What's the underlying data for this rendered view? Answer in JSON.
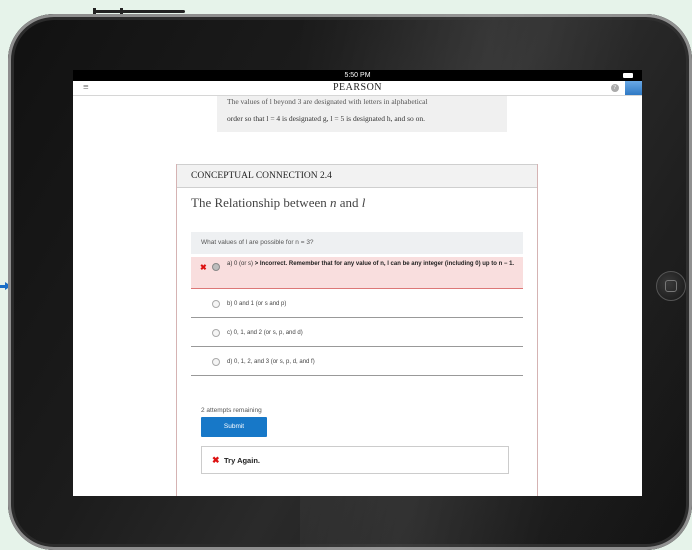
{
  "status_bar": {
    "time": "5:50 PM"
  },
  "app_bar": {
    "brand": "PEARSON",
    "menu_glyph": "≡",
    "help_glyph": "?"
  },
  "previous_passage": {
    "line1": "The values of l beyond 3 are designated with letters in alphabetical",
    "line2": "order so that l = 4 is designated g, l = 5 is designated h, and so on."
  },
  "card": {
    "header": "CONCEPTUAL CONNECTION 2.4",
    "title_prefix": "The Relationship between ",
    "title_n": "n",
    "title_and": " and ",
    "title_l": "l",
    "question": "What values of l are possible for n = 3?",
    "options": [
      {
        "label": "a) 0 (or s)",
        "feedback_bold": "> Incorrect. Remember that for any value of n, l can be any integer (including 0) up to n − 1.",
        "state": "incorrect-selected"
      },
      {
        "label": "b) 0 and 1 (or s and p)",
        "state": "unselected"
      },
      {
        "label": "c) 0, 1, and 2 (or s, p, and d)",
        "state": "unselected"
      },
      {
        "label": "d) 0, 1, 2, and 3 (or s, p, d, and f)",
        "state": "unselected"
      }
    ],
    "attempts_text": "2 attempts remaining",
    "submit_label": "Submit",
    "result_icon": "x-mark-icon",
    "result_text": "Try Again."
  },
  "colors": {
    "incorrect_bg": "#f9dede",
    "submit_bg": "#1778c8",
    "error_red": "#d11"
  }
}
